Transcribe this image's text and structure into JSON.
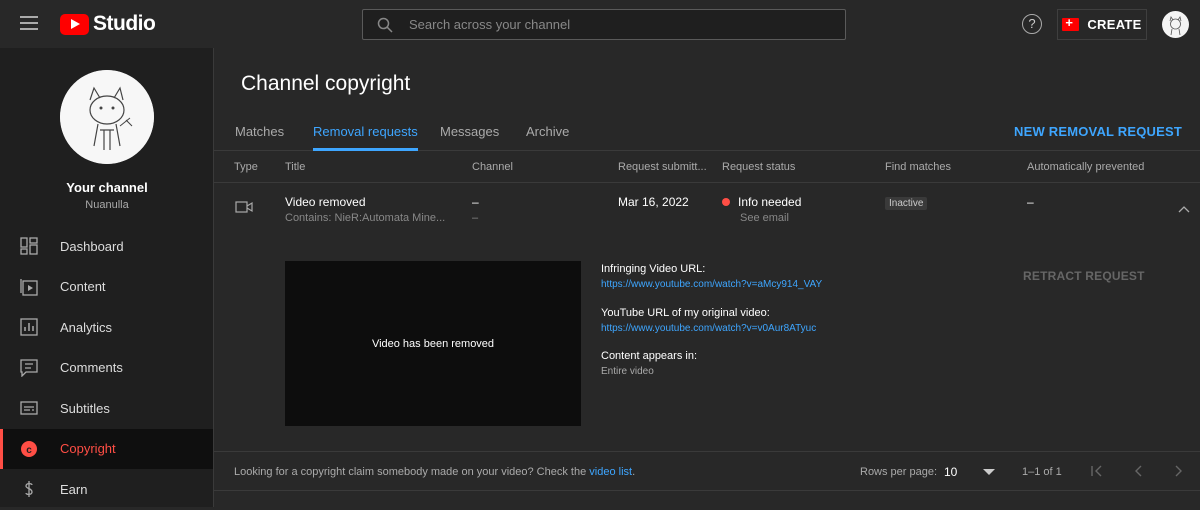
{
  "topbar": {
    "brand": "Studio",
    "search_placeholder": "Search across your channel",
    "help_label": "?",
    "create_label": "CREATE"
  },
  "sidebar": {
    "title": "Your channel",
    "channel_name": "Nuanulla",
    "items": [
      {
        "label": "Dashboard",
        "icon": "dashboard-icon"
      },
      {
        "label": "Content",
        "icon": "content-icon"
      },
      {
        "label": "Analytics",
        "icon": "analytics-icon"
      },
      {
        "label": "Comments",
        "icon": "comments-icon"
      },
      {
        "label": "Subtitles",
        "icon": "subtitles-icon"
      },
      {
        "label": "Copyright",
        "icon": "copyright-icon",
        "active": true
      },
      {
        "label": "Earn",
        "icon": "earn-icon"
      }
    ]
  },
  "main": {
    "title": "Channel copyright",
    "tabs": [
      {
        "label": "Matches"
      },
      {
        "label": "Removal requests",
        "active": true
      },
      {
        "label": "Messages"
      },
      {
        "label": "Archive"
      }
    ],
    "new_request_label": "NEW REMOVAL REQUEST",
    "columns": [
      "Type",
      "Title",
      "Channel",
      "Request submitt...",
      "Request status",
      "Find matches",
      "Automatically prevented"
    ],
    "row": {
      "title": "Video removed",
      "contains": "Contains: NieR:Automata Mine...",
      "channel": "–",
      "channel_sub": "–",
      "date": "Mar 16, 2022",
      "status": "Info needed",
      "status_sub": "See email",
      "status_color": "#ff4e45",
      "find_matches": "Inactive",
      "auto_prevented": "–"
    },
    "detail": {
      "preview_text": "Video has been removed",
      "infringing_label": "Infringing Video URL:",
      "infringing_url": "https://www.youtube.com/watch?v=aMcy914_VAY",
      "original_label": "YouTube URL of my original video:",
      "original_url": "https://www.youtube.com/watch?v=v0Aur8ATyuc",
      "appears_label": "Content appears in:",
      "appears_value": "Entire video",
      "retract_label": "RETRACT REQUEST"
    },
    "footer": {
      "note": "Looking for a copyright claim somebody made on your video? Check the",
      "note_link": "video list",
      "note_end": ".",
      "rows_label": "Rows per page:",
      "rows_value": "10",
      "range": "1–1 of 1"
    }
  },
  "colors": {
    "accent": "#3ea6ff",
    "brand": "#ff0000",
    "active_nav": "#ff4e45"
  }
}
